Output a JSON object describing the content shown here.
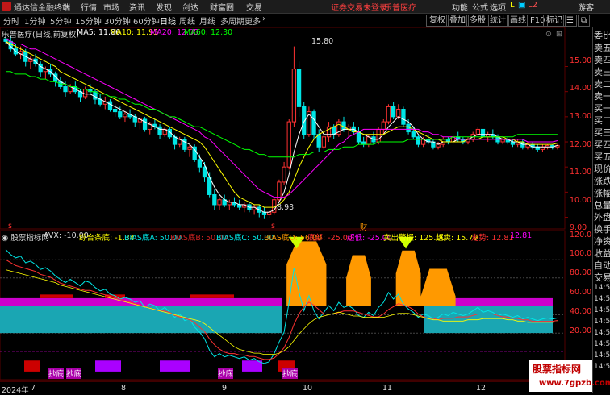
{
  "titlebar": {
    "app_name": "通达信金融终端",
    "menus": [
      "行情",
      "市场",
      "资讯",
      "发现",
      "剑达",
      "财富圈",
      "交易"
    ],
    "notice": "证券交易未登录",
    "stock": "乐普医疗",
    "right_menus": [
      "功能",
      "公式",
      "选项"
    ],
    "guest": "游客"
  },
  "toolbar": {
    "periods": [
      "分时",
      "1分钟",
      "5分钟",
      "15分钟",
      "30分钟",
      "60分钟",
      "日线",
      "周线",
      "月线",
      "多周期",
      "更多"
    ],
    "active_period": "日线",
    "right_buttons": [
      "复权",
      "叠加",
      "多股",
      "统计",
      "画线",
      "F10",
      "标记"
    ]
  },
  "main_info": {
    "stock_title": "乐普医疗(日线,前复权)",
    "ma5": "MA5: 11.86",
    "ma10": "MA10: 11.95",
    "ma20": "MA20: 12.05",
    "ma60": "MA60: 12.30"
  },
  "price_axis": [
    "15.00",
    "14.00",
    "13.00",
    "12.00",
    "11.00",
    "10.00",
    "9.00"
  ],
  "price_markers": {
    "high": "15.80",
    "low": "8.93",
    "cai": "财"
  },
  "indicator_info": {
    "name": "股票指标网",
    "avx": "AVX: -10.00",
    "zhsh": "综合条底: -1.34",
    "bias_a": "BIAS底A: 50.00",
    "bias_b": "BIAS底B: 50.00",
    "bias_c": "BIAS底C: 50.00",
    "bias_d": "BIAS底D: 56.00",
    "dibu": "底部: -25.00",
    "chaodi": "超低: -25.00",
    "maichu": "卖出警报: 125.00",
    "chaomai": "超卖: 15.79",
    "zoushi": "走势: 12.81",
    "last": "12.81"
  },
  "ind_axis": [
    "120.00",
    "100.00",
    "80.00",
    "60.00",
    "40.00",
    "20.00"
  ],
  "date_axis": [
    "2024年",
    "7",
    "8",
    "9",
    "10",
    "11",
    "12"
  ],
  "bottom_labels": {
    "a": "抄底",
    "b": "抄底",
    "c": "抄底",
    "d": "抄底"
  },
  "right_panel": [
    "委比",
    "卖五",
    "卖四",
    "卖三",
    "卖二",
    "卖一",
    "买一",
    "买二",
    "买三",
    "买四",
    "买五",
    "现价",
    "涨跌",
    "涨幅",
    "总量",
    "外盘",
    "换手",
    "净资",
    "收益",
    "自动",
    "交易",
    "14:56",
    "14:56",
    "14:56",
    "14:56",
    "14:56",
    "14:56",
    "14:56",
    "14:56"
  ],
  "watermark": {
    "line1": "股票指标网",
    "line2": "www.7gpzb.com"
  },
  "colors": {
    "up": "#ff3232",
    "down": "#00e5e5",
    "ma5": "#ffffff",
    "ma10": "#ffff00",
    "ma20": "#ff00ff",
    "ma60": "#00ff00",
    "orange": "#ff9900",
    "magenta": "#cc00cc",
    "cyan_fill": "#1aa6b3",
    "red_block": "#cc0000"
  },
  "chart_data": {
    "type": "candlestick",
    "ylim": [
      8.6,
      16.3
    ],
    "x_count": 112,
    "candles": [
      [
        16.1,
        16.3,
        15.9,
        16.0
      ],
      [
        16.0,
        16.2,
        15.6,
        15.7
      ],
      [
        15.7,
        15.9,
        15.4,
        15.5
      ],
      [
        15.5,
        15.8,
        15.3,
        15.6
      ],
      [
        15.6,
        15.7,
        15.0,
        15.2
      ],
      [
        15.2,
        15.4,
        14.9,
        15.3
      ],
      [
        15.3,
        15.5,
        15.0,
        15.1
      ],
      [
        15.1,
        15.2,
        14.6,
        14.8
      ],
      [
        14.8,
        15.0,
        14.5,
        14.9
      ],
      [
        14.9,
        15.1,
        14.6,
        14.7
      ],
      [
        14.7,
        14.8,
        14.2,
        14.4
      ],
      [
        14.4,
        14.6,
        14.1,
        14.2
      ],
      [
        14.2,
        14.4,
        13.8,
        14.0
      ],
      [
        14.0,
        14.3,
        13.9,
        14.2
      ],
      [
        14.2,
        14.4,
        13.9,
        14.0
      ],
      [
        14.0,
        14.1,
        13.6,
        13.8
      ],
      [
        13.8,
        14.2,
        13.7,
        14.1
      ],
      [
        14.1,
        14.3,
        13.9,
        14.0
      ],
      [
        14.0,
        14.1,
        13.5,
        13.7
      ],
      [
        13.7,
        13.9,
        13.4,
        13.5
      ],
      [
        13.5,
        13.8,
        13.3,
        13.6
      ],
      [
        13.6,
        13.7,
        13.2,
        13.3
      ],
      [
        13.3,
        13.5,
        13.0,
        13.2
      ],
      [
        13.2,
        13.4,
        12.9,
        13.0
      ],
      [
        13.0,
        13.2,
        12.8,
        13.1
      ],
      [
        13.1,
        13.3,
        12.9,
        13.0
      ],
      [
        13.0,
        13.1,
        12.6,
        12.8
      ],
      [
        12.8,
        13.0,
        12.5,
        12.9
      ],
      [
        12.9,
        13.0,
        12.4,
        12.5
      ],
      [
        12.5,
        12.8,
        12.3,
        12.7
      ],
      [
        12.7,
        12.9,
        12.5,
        12.6
      ],
      [
        12.6,
        12.7,
        12.1,
        12.3
      ],
      [
        12.3,
        12.6,
        12.2,
        12.5
      ],
      [
        12.5,
        12.6,
        12.1,
        12.2
      ],
      [
        12.2,
        12.3,
        11.7,
        11.9
      ],
      [
        11.9,
        12.2,
        11.8,
        12.1
      ],
      [
        12.1,
        12.2,
        11.6,
        11.7
      ],
      [
        11.7,
        11.9,
        11.4,
        11.8
      ],
      [
        11.8,
        11.9,
        11.2,
        11.3
      ],
      [
        11.3,
        11.5,
        10.8,
        11.0
      ],
      [
        11.0,
        11.2,
        10.4,
        10.6
      ],
      [
        10.6,
        10.8,
        9.8,
        9.9
      ],
      [
        9.9,
        10.1,
        9.3,
        9.5
      ],
      [
        9.5,
        9.8,
        9.3,
        9.7
      ],
      [
        9.7,
        9.9,
        9.4,
        9.5
      ],
      [
        9.5,
        9.7,
        9.3,
        9.6
      ],
      [
        9.6,
        9.8,
        9.4,
        9.5
      ],
      [
        9.5,
        9.7,
        9.3,
        9.4
      ],
      [
        9.4,
        9.6,
        9.2,
        9.5
      ],
      [
        9.5,
        9.6,
        9.2,
        9.3
      ],
      [
        9.3,
        9.5,
        9.1,
        9.4
      ],
      [
        9.4,
        9.5,
        9.0,
        9.2
      ],
      [
        9.2,
        9.4,
        8.93,
        9.1
      ],
      [
        9.1,
        9.3,
        8.95,
        9.2
      ],
      [
        9.2,
        9.8,
        9.1,
        9.7
      ],
      [
        9.7,
        10.5,
        9.6,
        10.4
      ],
      [
        10.4,
        11.2,
        10.3,
        11.0
      ],
      [
        11.0,
        12.9,
        10.9,
        12.8
      ],
      [
        12.8,
        15.8,
        12.6,
        14.9
      ],
      [
        14.9,
        15.2,
        13.0,
        13.4
      ],
      [
        13.4,
        13.6,
        12.1,
        12.3
      ],
      [
        12.3,
        13.4,
        12.2,
        13.2
      ],
      [
        13.2,
        13.3,
        12.1,
        12.3
      ],
      [
        12.3,
        12.5,
        11.6,
        11.8
      ],
      [
        11.8,
        12.3,
        11.7,
        12.2
      ],
      [
        12.2,
        12.8,
        12.0,
        12.6
      ],
      [
        12.6,
        12.7,
        12.1,
        12.3
      ],
      [
        12.3,
        12.9,
        12.2,
        12.8
      ],
      [
        12.8,
        13.0,
        12.4,
        12.5
      ],
      [
        12.5,
        12.7,
        12.2,
        12.6
      ],
      [
        12.6,
        12.8,
        12.3,
        12.4
      ],
      [
        12.4,
        12.6,
        11.9,
        12.0
      ],
      [
        12.0,
        12.2,
        11.8,
        11.9
      ],
      [
        11.9,
        12.3,
        11.8,
        12.2
      ],
      [
        12.2,
        12.4,
        11.9,
        12.0
      ],
      [
        12.0,
        12.6,
        11.9,
        12.5
      ],
      [
        12.5,
        12.9,
        12.3,
        12.8
      ],
      [
        12.8,
        13.5,
        12.7,
        13.4
      ],
      [
        13.4,
        13.6,
        12.9,
        13.0
      ],
      [
        13.0,
        13.5,
        12.9,
        13.3
      ],
      [
        13.3,
        13.4,
        12.6,
        12.7
      ],
      [
        12.7,
        12.9,
        12.3,
        12.4
      ],
      [
        12.4,
        12.6,
        12.1,
        12.2
      ],
      [
        12.2,
        12.3,
        11.8,
        11.9
      ],
      [
        11.9,
        12.2,
        11.8,
        12.1
      ],
      [
        12.1,
        12.3,
        11.9,
        12.0
      ],
      [
        12.0,
        12.1,
        11.7,
        11.8
      ],
      [
        11.8,
        12.0,
        11.7,
        11.9
      ],
      [
        11.9,
        12.2,
        11.8,
        12.1
      ],
      [
        12.1,
        12.2,
        11.9,
        12.0
      ],
      [
        12.0,
        12.3,
        11.9,
        12.2
      ],
      [
        12.2,
        12.4,
        12.0,
        12.1
      ],
      [
        12.1,
        12.2,
        11.9,
        12.0
      ],
      [
        12.0,
        12.2,
        11.9,
        12.1
      ],
      [
        12.1,
        12.4,
        12.0,
        12.3
      ],
      [
        12.3,
        12.6,
        12.2,
        12.5
      ],
      [
        12.5,
        12.6,
        12.1,
        12.2
      ],
      [
        12.2,
        12.4,
        12.0,
        12.3
      ],
      [
        12.3,
        12.5,
        12.1,
        12.2
      ],
      [
        12.2,
        12.3,
        11.9,
        12.0
      ],
      [
        12.0,
        12.2,
        11.9,
        12.1
      ],
      [
        12.1,
        12.2,
        11.9,
        12.0
      ],
      [
        12.0,
        12.1,
        11.8,
        11.9
      ],
      [
        11.9,
        12.1,
        11.8,
        12.0
      ],
      [
        12.0,
        12.1,
        11.7,
        11.8
      ],
      [
        11.8,
        12.0,
        11.7,
        11.9
      ],
      [
        11.9,
        12.0,
        11.7,
        11.8
      ],
      [
        11.8,
        11.9,
        11.6,
        11.7
      ],
      [
        11.7,
        11.9,
        11.6,
        11.8
      ],
      [
        11.8,
        11.9,
        11.7,
        11.86
      ],
      [
        11.86,
        11.9,
        11.7,
        11.8
      ],
      [
        11.8,
        11.9,
        11.7,
        11.86
      ]
    ],
    "ma_series": {
      "ma5": [
        16.0,
        15.8,
        15.6,
        15.5,
        15.4,
        15.3,
        15.2,
        15.0,
        14.9,
        14.8,
        14.6,
        14.4,
        14.3,
        14.2,
        14.1,
        14.0,
        13.9,
        13.9,
        13.8,
        13.7,
        13.6,
        13.5,
        13.4,
        13.3,
        13.2,
        13.1,
        13.0,
        12.9,
        12.8,
        12.7,
        12.6,
        12.5,
        12.5,
        12.4,
        12.2,
        12.1,
        12.0,
        11.9,
        11.7,
        11.4,
        11.1,
        10.6,
        10.2,
        9.9,
        9.7,
        9.6,
        9.6,
        9.5,
        9.5,
        9.4,
        9.4,
        9.3,
        9.2,
        9.2,
        9.3,
        9.6,
        10.0,
        10.7,
        11.6,
        12.3,
        12.8,
        13.1,
        12.9,
        12.6,
        12.3,
        12.3,
        12.3,
        12.4,
        12.5,
        12.5,
        12.5,
        12.4,
        12.3,
        12.2,
        12.1,
        12.1,
        12.3,
        12.6,
        12.8,
        13.0,
        12.9,
        12.8,
        12.6,
        12.3,
        12.1,
        12.0,
        12.0,
        11.9,
        12.0,
        12.0,
        12.0,
        12.1,
        12.1,
        12.1,
        12.2,
        12.3,
        12.3,
        12.3,
        12.3,
        12.2,
        12.1,
        12.1,
        12.0,
        12.0,
        11.9,
        11.9,
        11.8,
        11.8,
        11.8,
        11.8,
        11.8,
        11.86
      ],
      "ma10": [
        16.0,
        15.9,
        15.8,
        15.7,
        15.6,
        15.5,
        15.4,
        15.3,
        15.2,
        15.1,
        15.0,
        14.8,
        14.7,
        14.6,
        14.5,
        14.4,
        14.3,
        14.2,
        14.1,
        14.0,
        13.9,
        13.8,
        13.7,
        13.6,
        13.5,
        13.4,
        13.3,
        13.2,
        13.1,
        13.0,
        12.9,
        12.8,
        12.7,
        12.6,
        12.5,
        12.4,
        12.3,
        12.2,
        12.1,
        12.0,
        11.8,
        11.5,
        11.2,
        10.9,
        10.6,
        10.3,
        10.0,
        9.8,
        9.7,
        9.6,
        9.5,
        9.5,
        9.4,
        9.4,
        9.4,
        9.5,
        9.7,
        10.0,
        10.5,
        11.0,
        11.4,
        11.8,
        12.1,
        12.3,
        12.4,
        12.5,
        12.6,
        12.7,
        12.6,
        12.5,
        12.4,
        12.4,
        12.3,
        12.3,
        12.3,
        12.3,
        12.3,
        12.4,
        12.5,
        12.6,
        12.6,
        12.6,
        12.5,
        12.4,
        12.3,
        12.2,
        12.1,
        12.1,
        12.0,
        12.0,
        12.0,
        12.0,
        12.0,
        12.1,
        12.1,
        12.1,
        12.2,
        12.2,
        12.2,
        12.2,
        12.2,
        12.1,
        12.1,
        12.0,
        12.0,
        11.9,
        11.9,
        11.9,
        11.9,
        11.9,
        11.9,
        11.95
      ],
      "ma20": [
        16.1,
        16.0,
        15.9,
        15.9,
        15.8,
        15.7,
        15.7,
        15.6,
        15.5,
        15.4,
        15.3,
        15.2,
        15.1,
        15.0,
        14.9,
        14.8,
        14.7,
        14.6,
        14.5,
        14.4,
        14.3,
        14.2,
        14.1,
        14.0,
        13.9,
        13.8,
        13.7,
        13.6,
        13.5,
        13.4,
        13.3,
        13.2,
        13.1,
        13.0,
        12.9,
        12.8,
        12.7,
        12.6,
        12.5,
        12.4,
        12.2,
        12.1,
        11.9,
        11.7,
        11.5,
        11.3,
        11.1,
        10.9,
        10.7,
        10.5,
        10.3,
        10.1,
        10.0,
        9.9,
        9.8,
        9.8,
        9.8,
        9.9,
        10.1,
        10.3,
        10.5,
        10.7,
        10.9,
        11.1,
        11.3,
        11.5,
        11.7,
        11.9,
        12.0,
        12.2,
        12.3,
        12.4,
        12.5,
        12.5,
        12.5,
        12.5,
        12.5,
        12.5,
        12.5,
        12.5,
        12.5,
        12.5,
        12.5,
        12.5,
        12.4,
        12.4,
        12.3,
        12.3,
        12.2,
        12.2,
        12.2,
        12.1,
        12.1,
        12.1,
        12.1,
        12.1,
        12.1,
        12.1,
        12.1,
        12.1,
        12.1,
        12.1,
        12.1,
        12.1,
        12.1,
        12.0,
        12.0,
        12.0,
        12.0,
        12.0,
        12.0,
        12.05
      ],
      "ma60": [
        14.8,
        14.8,
        14.7,
        14.7,
        14.7,
        14.6,
        14.6,
        14.5,
        14.5,
        14.4,
        14.4,
        14.3,
        14.3,
        14.2,
        14.2,
        14.1,
        14.1,
        14.0,
        14.0,
        13.9,
        13.9,
        13.8,
        13.8,
        13.7,
        13.7,
        13.6,
        13.5,
        13.5,
        13.4,
        13.3,
        13.3,
        13.2,
        13.1,
        13.0,
        13.0,
        12.9,
        12.8,
        12.7,
        12.6,
        12.6,
        12.5,
        12.4,
        12.3,
        12.2,
        12.1,
        12.0,
        11.9,
        11.8,
        11.7,
        11.7,
        11.6,
        11.5,
        11.5,
        11.4,
        11.4,
        11.4,
        11.4,
        11.4,
        11.4,
        11.5,
        11.5,
        11.5,
        11.6,
        11.6,
        11.6,
        11.7,
        11.7,
        11.7,
        11.8,
        11.8,
        11.8,
        11.9,
        11.9,
        11.9,
        11.9,
        12.0,
        12.0,
        12.0,
        12.0,
        12.0,
        12.0,
        12.1,
        12.1,
        12.1,
        12.1,
        12.1,
        12.1,
        12.1,
        12.1,
        12.1,
        12.2,
        12.2,
        12.2,
        12.2,
        12.2,
        12.2,
        12.2,
        12.2,
        12.2,
        12.2,
        12.2,
        12.2,
        12.2,
        12.3,
        12.3,
        12.3,
        12.3,
        12.3,
        12.3,
        12.3,
        12.3,
        12.3
      ]
    },
    "indicator": {
      "ylim": [
        -30,
        130
      ],
      "orange_blocks": [
        [
          57,
          65,
          120,
          95
        ],
        [
          69,
          74,
          105,
          80
        ],
        [
          79,
          84,
          110,
          85
        ],
        [
          84,
          91,
          90,
          60
        ]
      ],
      "cyan_area": [
        [
          0,
          55
        ],
        [
          55,
          20
        ],
        [
          0,
          55
        ],
        [
          55,
          20
        ]
      ],
      "yellow_triangles": [
        59,
        81
      ]
    }
  }
}
